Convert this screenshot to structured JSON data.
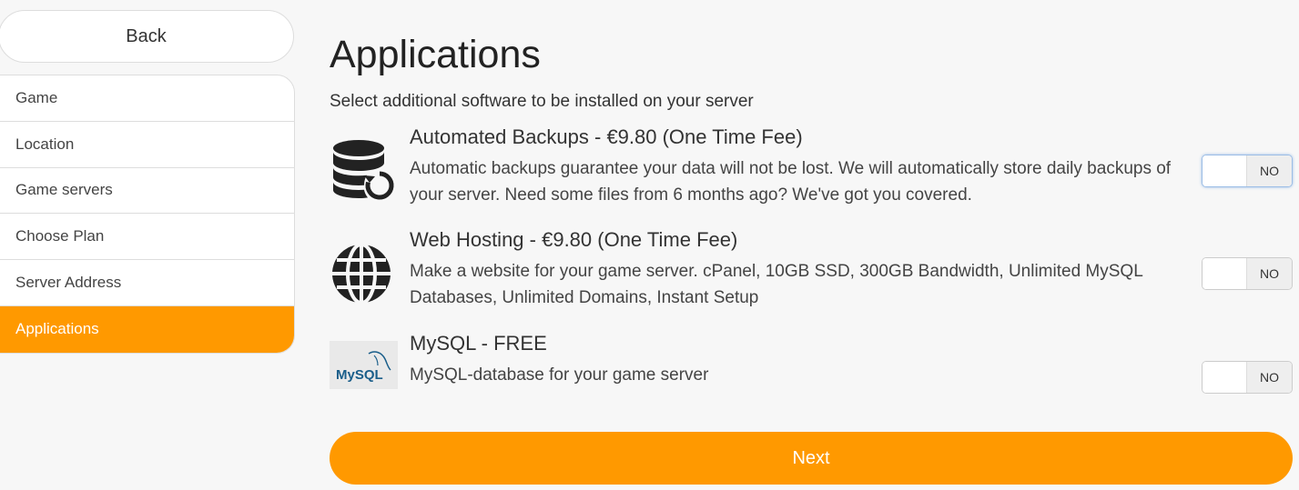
{
  "sidebar": {
    "back_label": "Back",
    "steps": [
      {
        "label": "Game"
      },
      {
        "label": "Location"
      },
      {
        "label": "Game servers"
      },
      {
        "label": "Choose Plan"
      },
      {
        "label": "Server Address"
      },
      {
        "label": "Applications",
        "active": true
      }
    ]
  },
  "main": {
    "title": "Applications",
    "subtitle": "Select additional software to be installed on your server",
    "apps": [
      {
        "name": "Automated Backups - €9.80 (One Time Fee)",
        "description": "Automatic backups guarantee your data will not be lost. We will automatically store daily backups of your server. Need some files from 6 months ago? We've got you covered.",
        "icon": "database-backup-icon",
        "toggle_state": "NO"
      },
      {
        "name": "Web Hosting - €9.80 (One Time Fee)",
        "description": "Make a website for your game server. cPanel, 10GB SSD, 300GB Bandwidth, Unlimited MySQL Databases, Unlimited Domains, Instant Setup",
        "icon": "globe-icon",
        "toggle_state": "NO"
      },
      {
        "name": "MySQL - FREE",
        "description": "MySQL-database for your game server",
        "icon": "mysql-logo-icon",
        "logo_text": "MySQL",
        "toggle_state": "NO"
      }
    ],
    "next_label": "Next"
  },
  "colors": {
    "accent": "#ff9900",
    "background": "#f7f7f7"
  }
}
